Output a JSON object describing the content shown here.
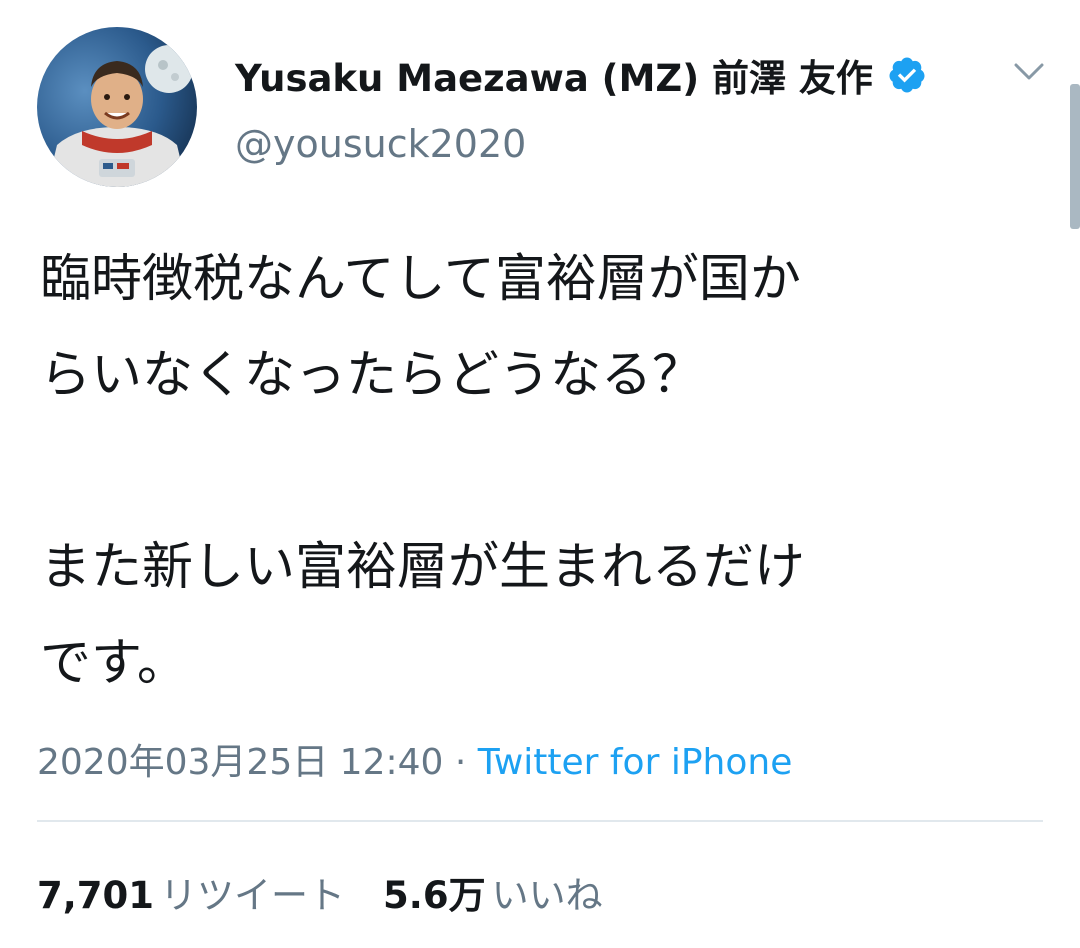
{
  "author": {
    "display_name": "Yusaku Maezawa (MZ) 前澤 友作",
    "handle": "@yousuck2020",
    "verified": true,
    "avatar_icon": "astronaut-avatar"
  },
  "tweet": {
    "text": "臨時徴税なんてして富裕層が国か\nらいなくなったらどうなる？\n\nまた新しい富裕層が生まれるだけ\nです。",
    "timestamp": "2020年03月25日 12:40",
    "separator": " · ",
    "source": "Twitter for iPhone"
  },
  "stats": {
    "retweets_count": "7,701",
    "retweets_label": "リツイート",
    "likes_count": "5.6万",
    "likes_label": "いいね"
  },
  "colors": {
    "text": "#14171a",
    "secondary": "#657786",
    "accent": "#1da1f2",
    "divider": "#e1e8ed"
  }
}
